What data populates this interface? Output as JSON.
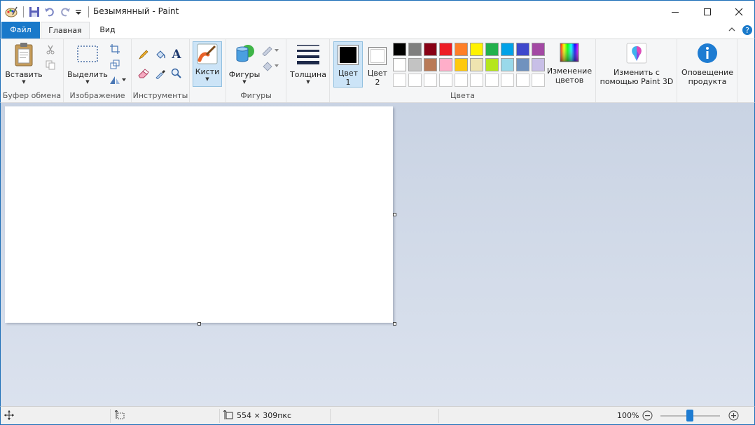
{
  "window": {
    "title": "Безымянный - Paint",
    "minimize": "—",
    "maximize": "☐",
    "close": "✕"
  },
  "tabs": [
    {
      "label": "Файл"
    },
    {
      "label": "Главная"
    },
    {
      "label": "Вид"
    }
  ],
  "ribbon": {
    "clipboard": {
      "paste": "Вставить",
      "group": "Буфер обмена"
    },
    "image": {
      "select": "Выделить",
      "group": "Изображение"
    },
    "tools": {
      "group": "Инструменты",
      "text_glyph": "A"
    },
    "brushes": {
      "label": "Кисти"
    },
    "shapes": {
      "label": "Фигуры",
      "group": "Фигуры"
    },
    "size": {
      "label": "Толщина"
    },
    "colors": {
      "color1_line1": "Цвет",
      "color1_line2": "1",
      "color2_line1": "Цвет",
      "color2_line2": "2",
      "edit_line1": "Изменение",
      "edit_line2": "цветов",
      "group": "Цвета",
      "color1": "#000000",
      "color2": "#ffffff",
      "palette_row1": [
        "#000000",
        "#7f7f7f",
        "#880015",
        "#ed1c24",
        "#ff7f27",
        "#fff200",
        "#22b14c",
        "#00a2e8",
        "#3f48cc",
        "#a349a4"
      ],
      "palette_row2": [
        "#ffffff",
        "#c3c3c3",
        "#b97a57",
        "#ffaec9",
        "#ffc90e",
        "#efe4b0",
        "#b5e61d",
        "#99d9ea",
        "#7092be",
        "#c8bfe7"
      ]
    },
    "paint3d": {
      "line1": "Изменить с",
      "line2": "помощью Paint 3D"
    },
    "notify": {
      "line1": "Оповещение",
      "line2": "продукта"
    }
  },
  "status": {
    "canvas_size": "554 × 309пкс",
    "zoom": "100%",
    "zoom_level": 100
  }
}
